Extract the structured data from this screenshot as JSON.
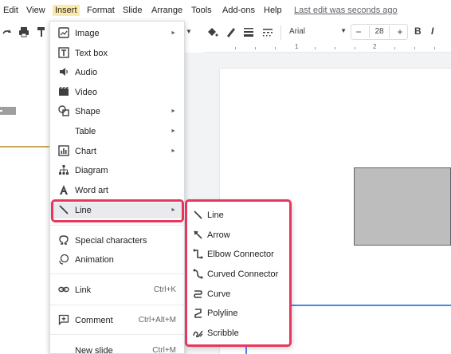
{
  "menubar": {
    "items": [
      "Edit",
      "View",
      "Insert",
      "Format",
      "Slide",
      "Arrange",
      "Tools",
      "Add-ons",
      "Help"
    ],
    "last_edit": "Last edit was seconds ago"
  },
  "toolbar": {
    "font": "Arial",
    "font_size": "28",
    "minus": "−",
    "plus": "+",
    "bold": "B",
    "italic": "I"
  },
  "ruler": {
    "labels": [
      "1",
      "2"
    ]
  },
  "insert_menu": {
    "items": [
      {
        "label": "Image",
        "icon": "image-icon",
        "submenu": true
      },
      {
        "label": "Text box",
        "icon": "text-box-icon",
        "submenu": false
      },
      {
        "label": "Audio",
        "icon": "audio-icon",
        "submenu": false
      },
      {
        "label": "Video",
        "icon": "video-icon",
        "submenu": false
      },
      {
        "label": "Shape",
        "icon": "shape-icon",
        "submenu": true
      },
      {
        "label": "Table",
        "icon": "",
        "submenu": true
      },
      {
        "label": "Chart",
        "icon": "chart-icon",
        "submenu": true
      },
      {
        "label": "Diagram",
        "icon": "diagram-icon",
        "submenu": false
      },
      {
        "label": "Word art",
        "icon": "word-art-icon",
        "submenu": false
      },
      {
        "label": "Line",
        "icon": "line-icon",
        "submenu": true
      },
      {
        "label": "Special characters",
        "icon": "omega-icon",
        "submenu": false
      },
      {
        "label": "Animation",
        "icon": "animation-icon",
        "submenu": false
      },
      {
        "label": "Link",
        "icon": "link-icon",
        "shortcut": "Ctrl+K"
      },
      {
        "label": "Comment",
        "icon": "comment-icon",
        "shortcut": "Ctrl+Alt+M"
      },
      {
        "label": "New slide",
        "icon": "",
        "shortcut": "Ctrl+M"
      }
    ]
  },
  "line_submenu": {
    "items": [
      {
        "label": "Line",
        "icon": "line-icon"
      },
      {
        "label": "Arrow",
        "icon": "arrow-icon"
      },
      {
        "label": "Elbow Connector",
        "icon": "elbow-connector-icon"
      },
      {
        "label": "Curved Connector",
        "icon": "curved-connector-icon"
      },
      {
        "label": "Curve",
        "icon": "curve-icon"
      },
      {
        "label": "Polyline",
        "icon": "polyline-icon"
      },
      {
        "label": "Scribble",
        "icon": "scribble-icon"
      }
    ]
  },
  "colors": {
    "highlight_border": "#e8365d",
    "menu_active_bg": "#fde9a9",
    "guide": "#4285f4"
  }
}
